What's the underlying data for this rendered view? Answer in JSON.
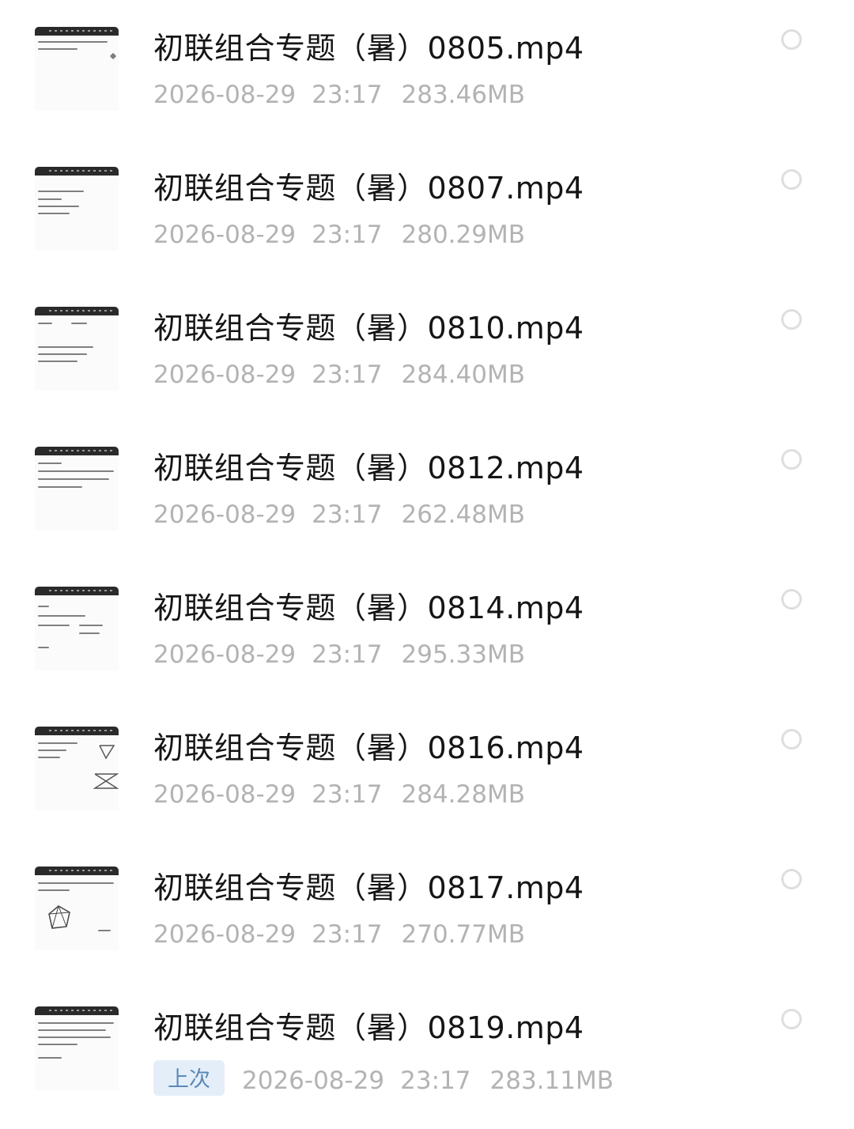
{
  "files": [
    {
      "name": "初联组合专题（暑）0805.mp4",
      "date": "2026-08-29",
      "time": "23:17",
      "size": "283.46MB",
      "badge": ""
    },
    {
      "name": "初联组合专题（暑）0807.mp4",
      "date": "2026-08-29",
      "time": "23:17",
      "size": "280.29MB",
      "badge": ""
    },
    {
      "name": "初联组合专题（暑）0810.mp4",
      "date": "2026-08-29",
      "time": "23:17",
      "size": "284.40MB",
      "badge": ""
    },
    {
      "name": "初联组合专题（暑）0812.mp4",
      "date": "2026-08-29",
      "time": "23:17",
      "size": "262.48MB",
      "badge": ""
    },
    {
      "name": "初联组合专题（暑）0814.mp4",
      "date": "2026-08-29",
      "time": "23:17",
      "size": "295.33MB",
      "badge": ""
    },
    {
      "name": "初联组合专题（暑）0816.mp4",
      "date": "2026-08-29",
      "time": "23:17",
      "size": "284.28MB",
      "badge": ""
    },
    {
      "name": "初联组合专题（暑）0817.mp4",
      "date": "2026-08-29",
      "time": "23:17",
      "size": "270.77MB",
      "badge": ""
    },
    {
      "name": "初联组合专题（暑）0819.mp4",
      "date": "2026-08-29",
      "time": "23:17",
      "size": "283.11MB",
      "badge": "上次"
    }
  ],
  "icons": {
    "thumbnail": "video-thumbnail-icon",
    "select": "radio-unchecked-icon"
  },
  "colors": {
    "title": "#151515",
    "meta": "#b3b3b3",
    "badge_bg": "#e4eef8",
    "badge_text": "#5c88b8",
    "circle": "#dedede"
  }
}
